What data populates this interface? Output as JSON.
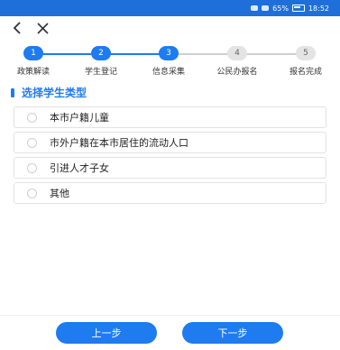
{
  "status_bar": {
    "battery": "65%",
    "time": "18:52"
  },
  "nav": {
    "back_icon": "back-chevron-icon",
    "close_icon": "close-icon"
  },
  "steps": [
    {
      "num": "1",
      "label": "政策解读",
      "active": true
    },
    {
      "num": "2",
      "label": "学生登记",
      "active": true
    },
    {
      "num": "3",
      "label": "信息采集",
      "active": true
    },
    {
      "num": "4",
      "label": "公民办报名",
      "active": false
    },
    {
      "num": "5",
      "label": "报名完成",
      "active": false
    }
  ],
  "section": {
    "title": "选择学生类型"
  },
  "options": [
    {
      "label": "本市户籍儿童"
    },
    {
      "label": "市外户籍在本市居住的流动人口"
    },
    {
      "label": "引进人才子女"
    },
    {
      "label": "其他"
    }
  ],
  "buttons": {
    "prev": "上一步",
    "next": "下一步"
  },
  "colors": {
    "accent": "#1e7bf0",
    "status_bar": "#1e6fd9"
  }
}
